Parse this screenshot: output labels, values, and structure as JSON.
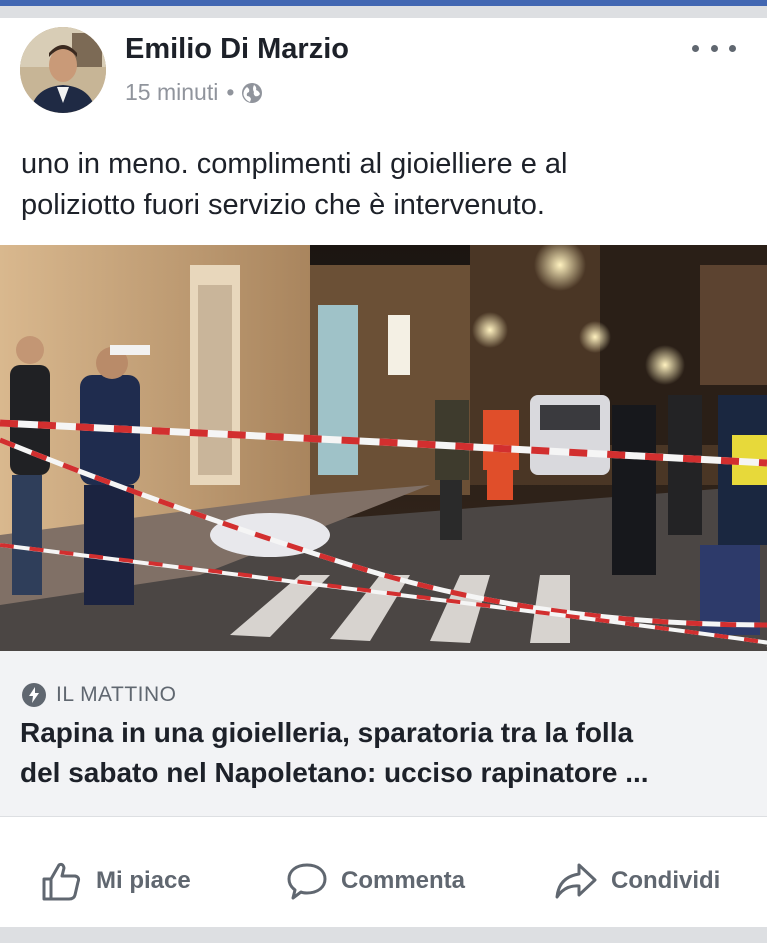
{
  "post": {
    "author": "Emilio Di Marzio",
    "time": "15 minuti",
    "separator": "•",
    "privacy_icon": "globe-icon",
    "more_icon": "more-options-icon",
    "text_line1": "uno in meno. complimenti al gioielliere e al",
    "text_line2": "poliziotto fuori servizio che è intervenuto."
  },
  "link": {
    "source": "IL MATTINO",
    "source_icon": "lightning-badge-icon",
    "headline_line1": "Rapina in una gioielleria, sparatoria tra la folla",
    "headline_line2": "del sabato nel Napoletano: ucciso rapinatore ..."
  },
  "actions": {
    "like": "Mi piace",
    "comment": "Commenta",
    "share": "Condividi"
  },
  "colors": {
    "brand": "#4267b2",
    "text": "#1d2129",
    "muted": "#606770"
  }
}
